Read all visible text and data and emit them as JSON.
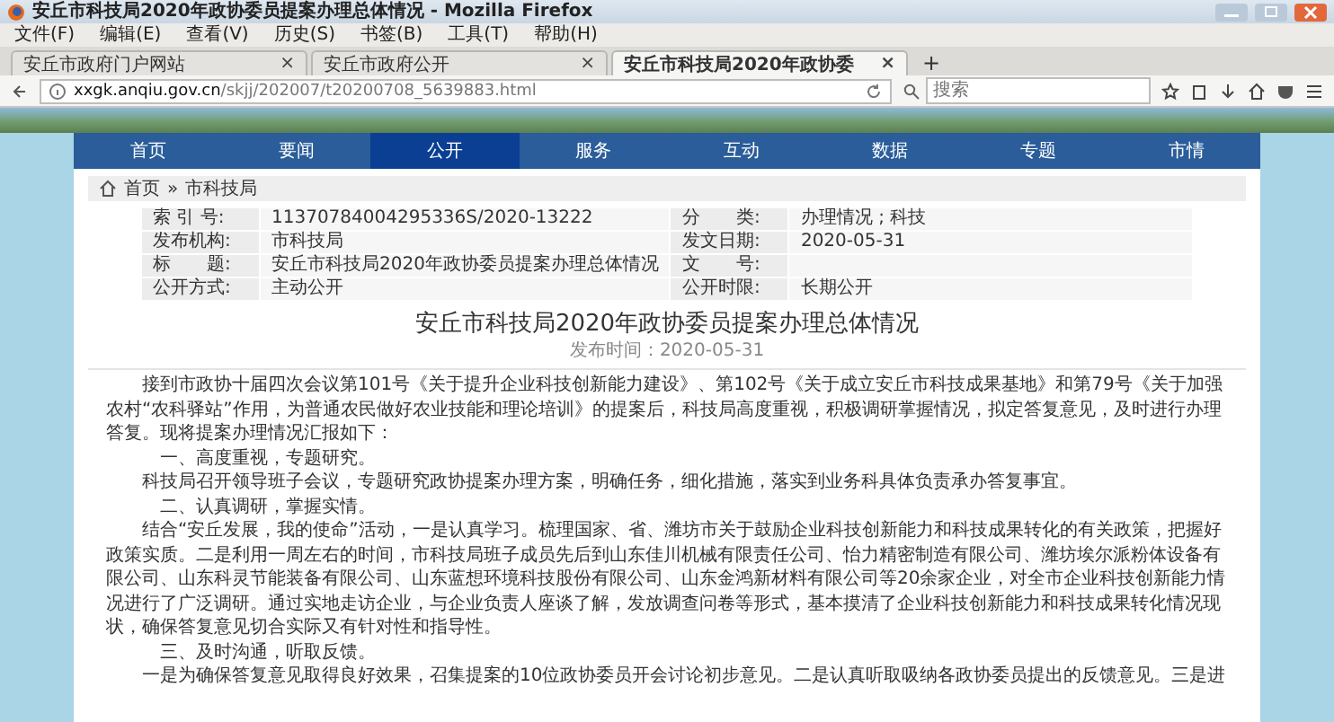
{
  "browser": {
    "title": "安丘市科技局2020年政协委员提案办理总体情况 - Mozilla Firefox",
    "menu": [
      "文件(F)",
      "编辑(E)",
      "查看(V)",
      "历史(S)",
      "书签(B)",
      "工具(T)",
      "帮助(H)"
    ],
    "tabs": [
      {
        "label": "安丘市政府门户网站",
        "close": "×",
        "selected": false
      },
      {
        "label": "安丘市政府公开",
        "close": "×",
        "selected": false
      },
      {
        "label": "安丘市科技局2020年政协委",
        "close": "×",
        "selected": true
      }
    ],
    "new_tab": "+",
    "url_host": "xxgk.anqiu.gov.cn",
    "url_path": "/skjj/202007/t20200708_5639883.html",
    "search": {
      "placeholder": "搜索"
    }
  },
  "nav": [
    {
      "label": "首页",
      "selected": false
    },
    {
      "label": "要闻",
      "selected": false
    },
    {
      "label": "公开",
      "selected": true
    },
    {
      "label": "服务",
      "selected": false
    },
    {
      "label": "互动",
      "selected": false
    },
    {
      "label": "数据",
      "selected": false
    },
    {
      "label": "专题",
      "selected": false
    },
    {
      "label": "市情",
      "selected": false
    }
  ],
  "breadcrumb": {
    "items": [
      "首页",
      "市科技局"
    ],
    "separator": "»"
  },
  "info": [
    {
      "cells": [
        {
          "label": "索 引 号:",
          "value": "11370784004295336S/2020-13222"
        },
        {
          "label": "分　　类:",
          "value": "办理情况 ; 科技"
        }
      ]
    },
    {
      "cells": [
        {
          "label": "发布机构:",
          "value": "市科技局"
        },
        {
          "label": "发文日期:",
          "value": "2020-05-31"
        }
      ]
    },
    {
      "cells": [
        {
          "label": "标　　题:",
          "value": "安丘市科技局2020年政协委员提案办理总体情况"
        },
        {
          "label": "文　　号:"
        }
      ]
    },
    {
      "cells": [
        {
          "label": "公开方式:",
          "value": "主动公开"
        },
        {
          "label": "公开时限:",
          "value": "长期公开"
        }
      ]
    }
  ],
  "article": {
    "title": "安丘市科技局2020年政协委员提案办理总体情况",
    "date": "发布时间：2020-05-31",
    "paragraphs": [
      {
        "kind": "text",
        "text": "接到市政协十届四次会议第101号《关于提升企业科技创新能力建设》、第102号《关于成立安丘市科技成果基地》和第79号《关于加强农村“农科驿站”作用，为普通农民做好农业技能和理论培训》的提案后，科技局高度重视，积极调研掌握情况，拟定答复意见，及时进行办理答复。现将提案办理情况汇报如下："
      },
      {
        "kind": "heading",
        "text": "一、高度重视，专题研究。"
      },
      {
        "kind": "text",
        "text": "科技局召开领导班子会议，专题研究政协提案办理方案，明确任务，细化措施，落实到业务科具体负责承办答复事宜。"
      },
      {
        "kind": "heading",
        "text": "二、认真调研，掌握实情。"
      },
      {
        "kind": "text",
        "text": "结合“安丘发展，我的使命”活动，一是认真学习。梳理国家、省、潍坊市关于鼓励企业科技创新能力和科技成果转化的有关政策，把握好政策实质。二是利用一周左右的时间，市科技局班子成员先后到山东佳川机械有限责任公司、怡力精密制造有限公司、潍坊埃尔派粉体设备有限公司、山东科灵节能装备有限公司、山东蓝想环境科技股份有限公司、山东金鸿新材料有限公司等20余家企业，对全市企业科技创新能力情况进行了广泛调研。通过实地走访企业，与企业负责人座谈了解，发放调查问卷等形式，基本摸清了企业科技创新能力和科技成果转化情况现状，确保答复意见切合实际又有针对性和指导性。"
      },
      {
        "kind": "heading",
        "text": "三、及时沟通，听取反馈。"
      },
      {
        "kind": "text",
        "text": "一是为确保答复意见取得良好效果，召集提案的10位政协委员开会讨论初步意见。二是认真听取吸纳各政协委员提出的反馈意见。三是进"
      }
    ]
  }
}
